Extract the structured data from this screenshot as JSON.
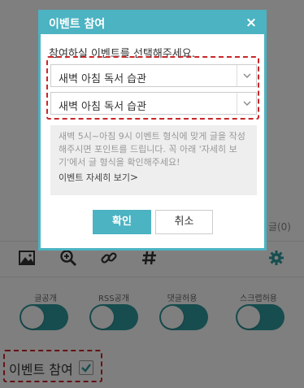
{
  "background": {
    "comment_count": "글(0)",
    "toolbar": {
      "icons": [
        "image-icon",
        "zoom-in-icon",
        "link-icon",
        "hashtag-icon",
        "gear-icon"
      ]
    },
    "toggles": [
      {
        "label": "글공개",
        "on": true
      },
      {
        "label": "RSS공개",
        "on": true
      },
      {
        "label": "댓글허용",
        "on": true
      },
      {
        "label": "스크랩허용",
        "on": true
      }
    ],
    "event_participation": {
      "label": "이벤트 참여",
      "checked": true
    }
  },
  "modal": {
    "title": "이벤트 참여",
    "close_glyph": "×",
    "instruction": "참여하실 이벤트를 선택해주세요.",
    "selects": [
      {
        "value": "새벽 아침 독서 습관"
      },
      {
        "value": "새벽 아침 독서 습관"
      }
    ],
    "info": {
      "text": "새벽 5시~아침 9시 이벤트 형식에 맞게 글을 작성해주시면 포인트를 드립니다. 꼭 아래 '자세히 보기'에서 글 형식을 확인해주세요!",
      "link_label": "이벤트 자세히 보기",
      "link_chevron": ">"
    },
    "buttons": {
      "ok": "확인",
      "cancel": "취소"
    }
  },
  "colors": {
    "accent": "#4bb3c2",
    "toggle_on": "#2f9a9e",
    "highlight_dashed": "#c8282a"
  }
}
